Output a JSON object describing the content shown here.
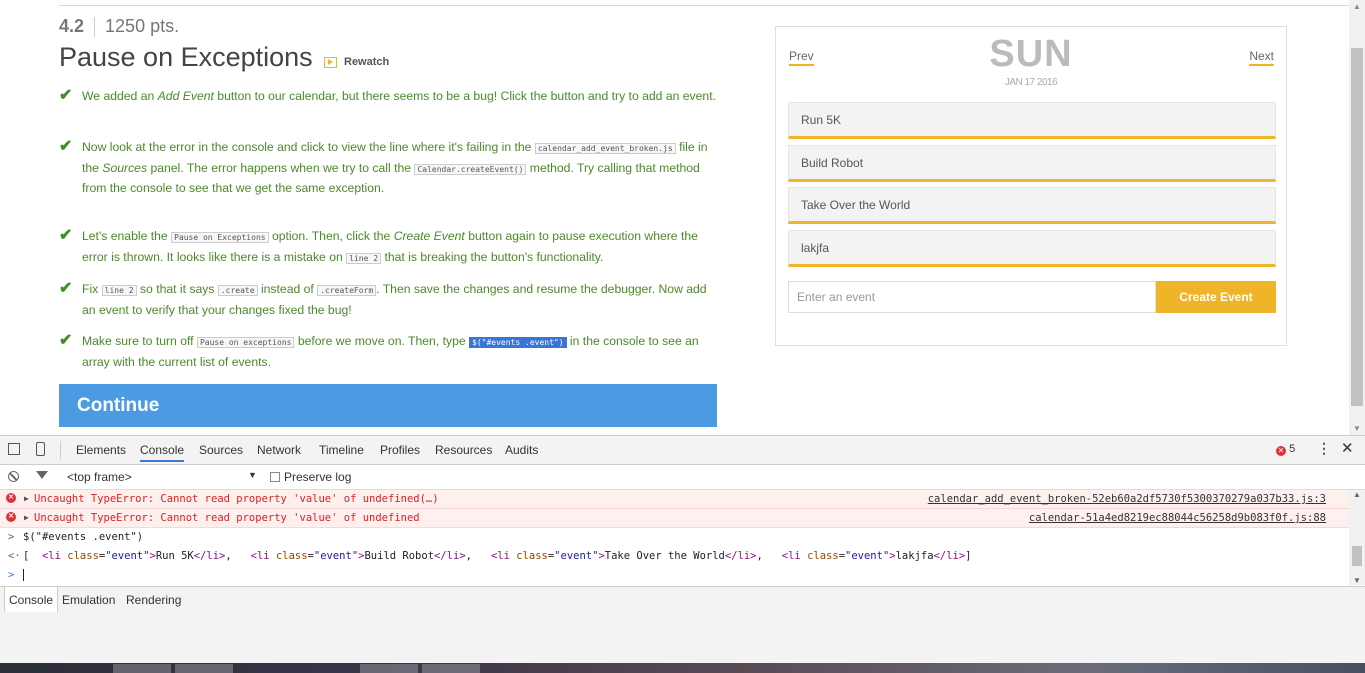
{
  "lesson": {
    "number": "4.2",
    "points": "1250 pts.",
    "title": "Pause on Exceptions",
    "rewatch_label": "Rewatch"
  },
  "tasks": [
    {
      "segments": [
        "We added an ",
        "Add Event",
        " button to our calendar, but there seems to be a bug! Click the button and try to add an event."
      ]
    },
    {
      "segments": [
        "Now look at the error in the console and click to view the line where it's failing in the ",
        "calendar_add_event_broken.js",
        " file in the ",
        "Sources",
        " panel. The error happens when we try to call the ",
        "Calendar.createEvent()",
        " method. Try calling that method from the console to see that we get the same exception."
      ]
    },
    {
      "segments": [
        "Let's enable the ",
        "Pause on Exceptions",
        " option. Then, click the ",
        "Create Event",
        " button again to pause execution where the error is thrown. It looks like there is a mistake on ",
        "line 2",
        " that is breaking the button's functionality."
      ]
    },
    {
      "segments": [
        "Fix ",
        "line 2",
        " so that it says ",
        ".create",
        " instead of ",
        ".createForm",
        ". Then save the changes and resume the debugger. Now add an event to verify that your changes fixed the bug!"
      ]
    },
    {
      "segments": [
        "Make sure to turn off ",
        "Pause on exceptions",
        " before we move on. Then, type ",
        "$(\"#events .event\")",
        " in the console to see an array with the current list of events."
      ]
    }
  ],
  "continue_label": "Continue",
  "calendar": {
    "prev_label": "Prev",
    "next_label": "Next",
    "day": "SUN",
    "date": "JAN 17 2016",
    "events": [
      "Run 5K",
      "Build Robot",
      "Take Over the World",
      "lakjfa"
    ],
    "input_placeholder": "Enter an event",
    "create_label": "Create Event",
    "accent_color": "#f0b429"
  },
  "devtools": {
    "tabs": [
      "Elements",
      "Console",
      "Sources",
      "Network",
      "Timeline",
      "Profiles",
      "Resources",
      "Audits"
    ],
    "active_tab": "Console",
    "error_count": "5",
    "frame_select": "<top frame>",
    "preserve_log_label": "Preserve log",
    "console": {
      "errors": [
        {
          "message": "Uncaught TypeError: Cannot read property 'value' of undefined(…)",
          "source": "calendar_add_event_broken-52eb60a2df5730f5300370279a037b33.js:3"
        },
        {
          "message": "Uncaught TypeError: Cannot read property 'value' of undefined",
          "source": "calendar-51a4ed8219ec88044c56258d9b083f0f.js:88"
        }
      ],
      "input_command": "$(\"#events .event\")",
      "result_open": "[",
      "result_items": [
        "Run 5K",
        "Build Robot",
        "Take Over the World",
        "lakjfa"
      ],
      "result_close": "]",
      "li_tag_open": "<li",
      "li_attr": "class",
      "li_attr_value": "\"event\"",
      "li_tag_close": "</li>"
    },
    "drawer_tabs": [
      "Console",
      "Emulation",
      "Rendering"
    ],
    "active_drawer_tab": "Console",
    "error_color": "#e0303a"
  }
}
